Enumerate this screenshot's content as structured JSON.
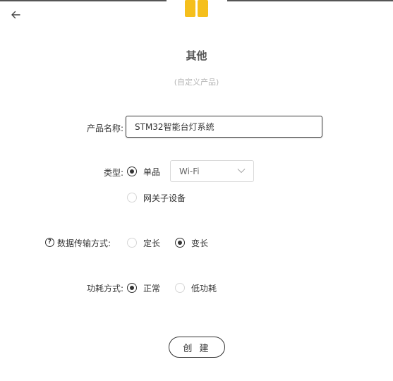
{
  "header": {
    "back_icon": "arrow-left-icon",
    "logo_icon": "four-squares-logo",
    "title": "其他",
    "subtitle": "(自定义产品)"
  },
  "form": {
    "name_label": "产品名称:",
    "name_value": "STM32智能台灯系统",
    "type": {
      "label": "类型:",
      "options": [
        {
          "label": "单品",
          "checked": true
        },
        {
          "label": "网关子设备",
          "checked": false
        }
      ],
      "connection_select": {
        "value": "Wi-Fi"
      }
    },
    "data_transfer": {
      "label": "数据传输方式:",
      "help_icon": "question-circle-icon",
      "options": [
        {
          "label": "定长",
          "checked": false
        },
        {
          "label": "变长",
          "checked": true
        }
      ]
    },
    "power": {
      "label": "功耗方式:",
      "options": [
        {
          "label": "正常",
          "checked": true
        },
        {
          "label": "低功耗",
          "checked": false
        }
      ]
    }
  },
  "actions": {
    "create_label": "创 建"
  },
  "colors": {
    "accent_yellow": "#f5bf1c",
    "border_dark": "#333333",
    "text_muted": "#b7b7b7"
  }
}
